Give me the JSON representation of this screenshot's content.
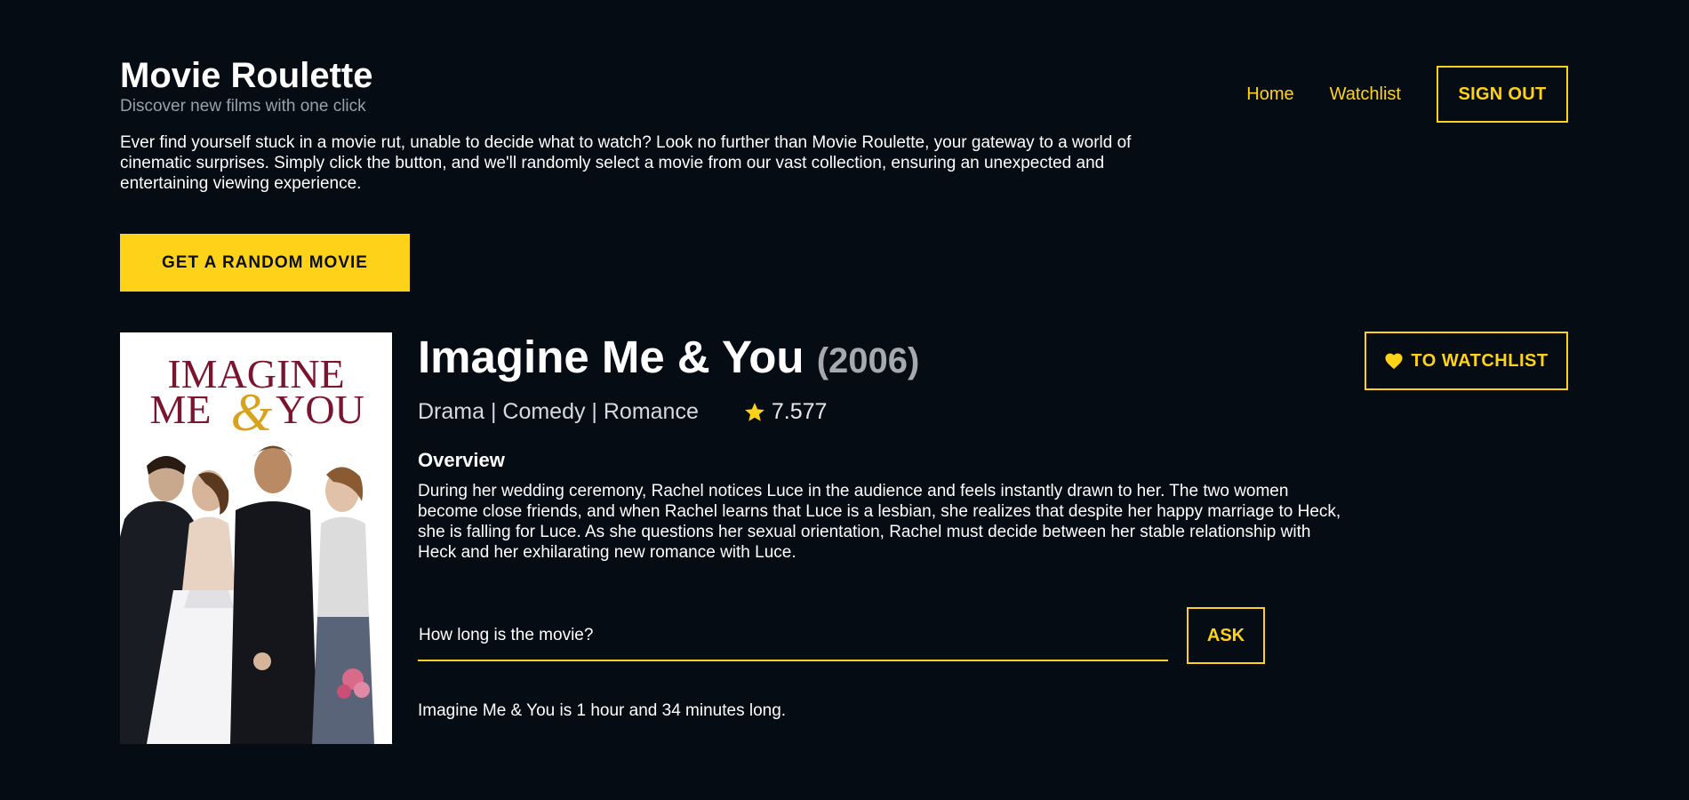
{
  "header": {
    "app_title": "Movie Roulette",
    "app_subtitle": "Discover new films with one click",
    "nav": {
      "home": "Home",
      "watchlist": "Watchlist",
      "sign_out": "SIGN OUT"
    }
  },
  "intro": "Ever find yourself stuck in a movie rut, unable to decide what to watch? Look no further than Movie Roulette, your gateway to a world of cinematic surprises. Simply click the button, and we'll randomly select a movie from our vast collection, ensuring an unexpected and entertaining viewing experience.",
  "random_button": "GET A RANDOM MOVIE",
  "movie": {
    "title": "Imagine Me & You",
    "year": "(2006)",
    "genres": "Drama | Comedy | Romance",
    "rating": "7.577",
    "poster_line1": "IMAGINE",
    "poster_line2_left": "ME",
    "poster_ampersand": "&",
    "poster_line2_right": "YOU",
    "watchlist_button": "TO WATCHLIST",
    "overview_heading": "Overview",
    "overview": "During her wedding ceremony, Rachel notices Luce in the audience and feels instantly drawn to her. The two women become close friends, and when Rachel learns that Luce is a lesbian, she realizes that despite her happy marriage to Heck, she is falling for Luce. As she questions her sexual orientation, Rachel must decide between her stable relationship with Heck and her exhilarating new romance with Luce."
  },
  "ask": {
    "question_value": "How long is the movie?",
    "button": "ASK",
    "answer": "Imagine Me & You is 1 hour and 34 minutes long."
  },
  "colors": {
    "background": "#060c14",
    "accent": "#ffd21a",
    "poster_title": "#7a1530",
    "poster_ampersand": "#d9a21b"
  },
  "icons": {
    "rating": "star-icon",
    "watchlist": "heart-icon"
  }
}
